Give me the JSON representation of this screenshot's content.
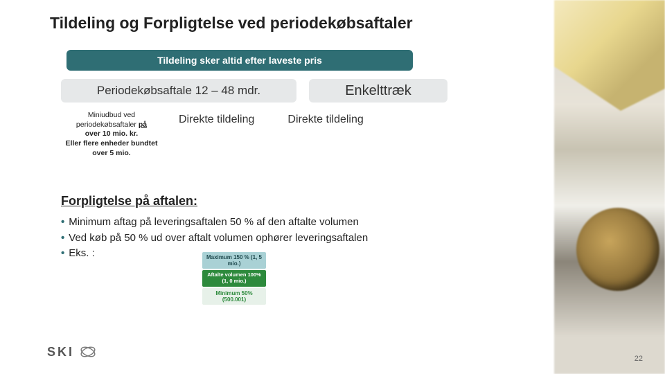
{
  "title": "Tildeling og Forpligtelse ved periodekøbsaftaler",
  "header_band": "Tildeling sker altid efter laveste pris",
  "pill_left": "Periodekøbsaftale 12 – 48 mdr.",
  "pill_right": "Enkelttræk",
  "note": {
    "line1_a": "Miniudbud ved",
    "line1_b": "periodekøbsaftaler",
    "line1_c": "på",
    "line2": "over 10 mio. kr.",
    "line3": "Eller flere enheder bundtet over 5 mio."
  },
  "dt1": "Direkte tildeling",
  "dt2": "Direkte tildeling",
  "section": "Forpligtelse på aftalen:",
  "bullets": [
    "Minimum aftag på leveringsaftalen 50 % af den aftalte volumen",
    "Ved køb på 50 % ud over aftalt volumen ophører leveringsaftalen",
    "Eks. :"
  ],
  "stack": {
    "b1": "Maximum 150 % (1, 5 mio.)",
    "b2": "Aftalte volumen 100% (1, 0 mio.)",
    "b3": "Minimum 50% (500.001)"
  },
  "logo_text": "SKI",
  "page_number": "22"
}
